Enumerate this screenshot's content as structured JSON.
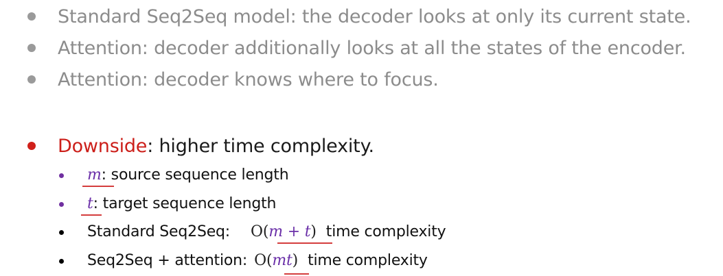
{
  "bullets": [
    {
      "text": "Standard Seq2Seq model: the decoder looks at only its current state."
    },
    {
      "text": "Attention: decoder additionally looks at all the states of the encoder."
    },
    {
      "text": "Attention: decoder knows where to focus."
    }
  ],
  "downside": {
    "highlight": "Downside",
    "rest": ": higher time complexity.",
    "sub_items": [
      {
        "math": "m",
        "text": ": source sequence length"
      },
      {
        "math": "t",
        "text": ": target sequence length"
      },
      {
        "label": "Standard Seq2Seq:",
        "big_o": "O",
        "open": "(",
        "arg": "m + t",
        "close": ")",
        "suffix": "time complexity"
      },
      {
        "label": "Seq2Seq + attention:",
        "big_o": "O",
        "open": "(",
        "arg": "mt",
        "close": ")",
        "suffix": "time complexity"
      }
    ]
  },
  "colors": {
    "gray_text": "#8c8c8c",
    "red_highlight": "#cc1f1a",
    "purple_math": "#6a2fa8",
    "underline_red": "#d43c3c"
  }
}
